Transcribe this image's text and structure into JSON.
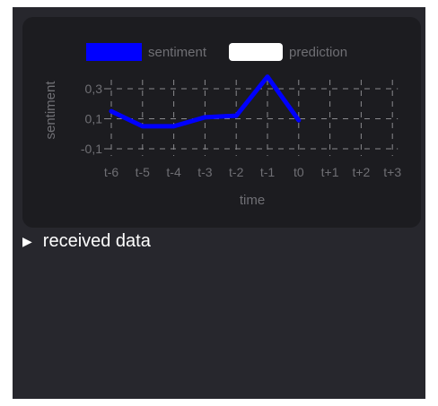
{
  "details": {
    "toggle_glyph": "▶",
    "label": "received data"
  },
  "chart_data": {
    "type": "line",
    "xlabel": "time",
    "ylabel": "sentiment",
    "categories": [
      "t-6",
      "t-5",
      "t-4",
      "t-3",
      "t-2",
      "t-1",
      "t0",
      "t+1",
      "t+2",
      "t+3"
    ],
    "y_ticks": [
      "-0,1",
      "0,1",
      "0,3"
    ],
    "y_tick_values": [
      -0.1,
      0.1,
      0.3
    ],
    "ylim": [
      -0.1,
      0.3
    ],
    "grid": true,
    "legend_position": "top",
    "series": [
      {
        "name": "sentiment",
        "color": "#0000ff",
        "values": [
          0.15,
          0.05,
          0.05,
          0.11,
          0.12,
          0.38,
          0.09,
          null,
          null,
          null
        ]
      },
      {
        "name": "prediction",
        "color": "#ffffff",
        "values": [
          null,
          null,
          null,
          null,
          null,
          null,
          null,
          null,
          null,
          null
        ]
      }
    ]
  }
}
